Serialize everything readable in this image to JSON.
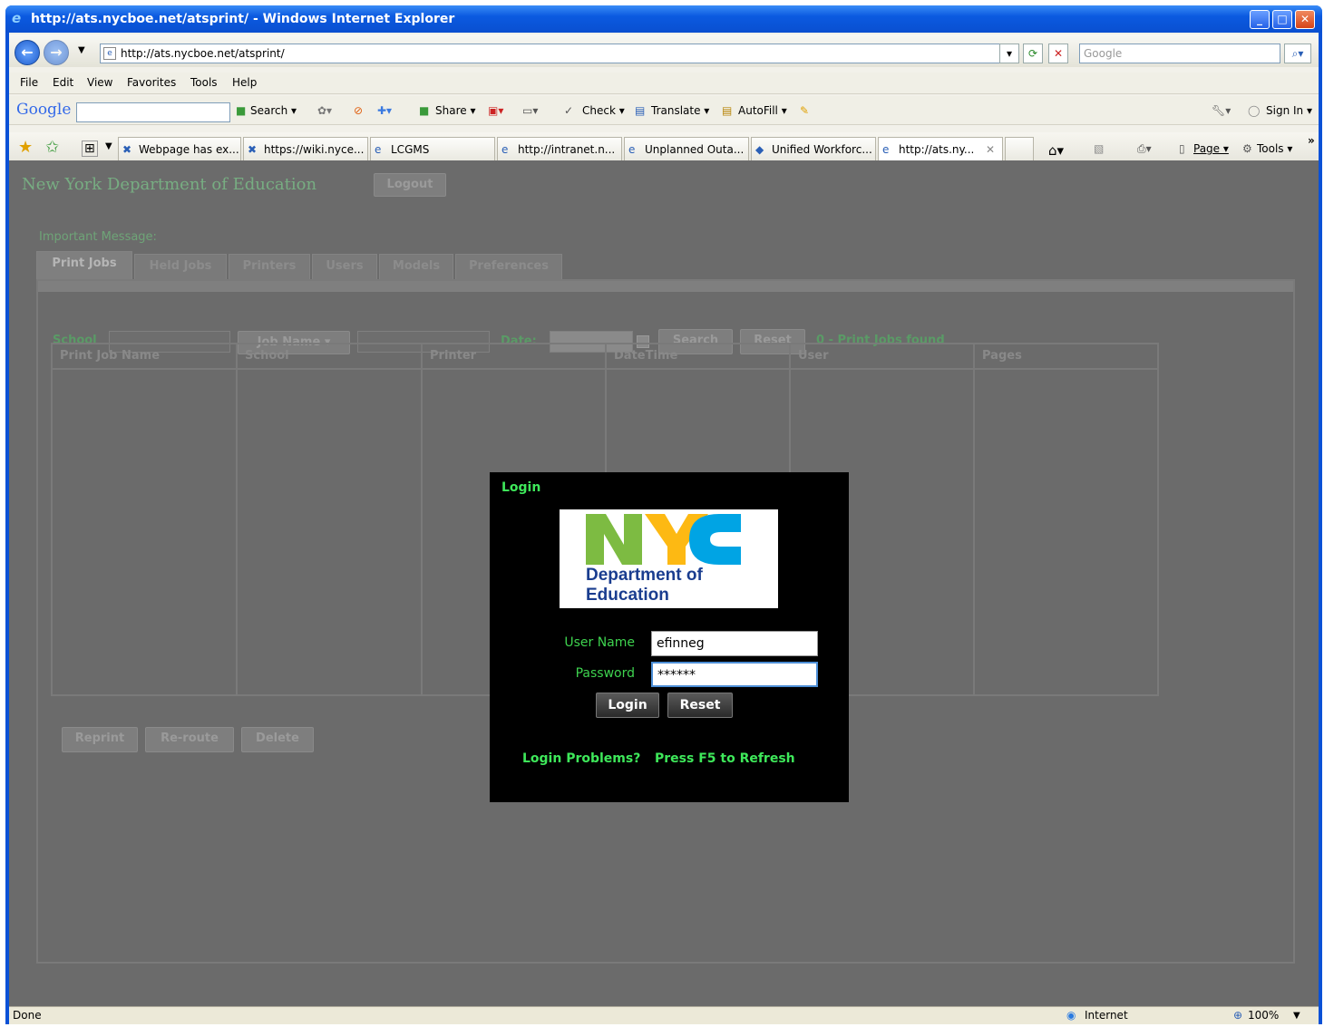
{
  "window": {
    "title": "http://ats.nycboe.net/atsprint/ - Windows Internet Explorer",
    "minimize": "_",
    "maximize": "□",
    "close": "✕"
  },
  "address": {
    "url": "http://ats.nycboe.net/atsprint/",
    "search_placeholder": "Google"
  },
  "menu": [
    "File",
    "Edit",
    "View",
    "Favorites",
    "Tools",
    "Help"
  ],
  "google_toolbar": {
    "logo": "Google",
    "items": [
      "Search ▾",
      "Share ▾",
      "Check ▾",
      "Translate ▾",
      "AutoFill ▾"
    ],
    "sign_in": "Sign In ▾"
  },
  "tabs": [
    {
      "label": "Webpage has ex..."
    },
    {
      "label": "https://wiki.nyce..."
    },
    {
      "label": "LCGMS"
    },
    {
      "label": "http://intranet.n..."
    },
    {
      "label": "Unplanned Outa..."
    },
    {
      "label": "Unified Workforc..."
    },
    {
      "label": "http://ats.ny..."
    }
  ],
  "command_bar": {
    "page": "Page ▾",
    "tools": "Tools ▾"
  },
  "app": {
    "header": "New York Department of Education",
    "logout": "Logout",
    "important_message": "Important Message:",
    "tabs": [
      "Print Jobs",
      "Held Jobs",
      "Printers",
      "Users",
      "Models",
      "Preferences"
    ],
    "filter": {
      "school_label": "School",
      "job_name_select": "Job Name",
      "date_label": "Date:",
      "search": "Search",
      "reset": "Reset",
      "found": "0 - Print Jobs found"
    },
    "columns": [
      "Print Job Name",
      "School",
      "Printer",
      "DateTime",
      "User",
      "Pages"
    ],
    "actions": [
      "Reprint",
      "Re-route",
      "Delete"
    ]
  },
  "login": {
    "title": "Login",
    "logo_line1": "Department of",
    "logo_line2": "Education",
    "username_label": "User Name",
    "username_value": "efinneg",
    "password_label": "Password",
    "password_value": "******",
    "login_button": "Login",
    "reset_button": "Reset",
    "problems_link": "Login Problems?",
    "refresh_hint": "Press F5 to Refresh"
  },
  "status": {
    "text": "Done",
    "zone": "Internet",
    "zoom": "100%"
  },
  "colors": {
    "accent_green": "#3ee85a",
    "nyc_green": "#7dbb42",
    "nyc_yellow": "#fdb913",
    "nyc_blue": "#00a4e4",
    "doe_navy": "#1a3d8f"
  }
}
